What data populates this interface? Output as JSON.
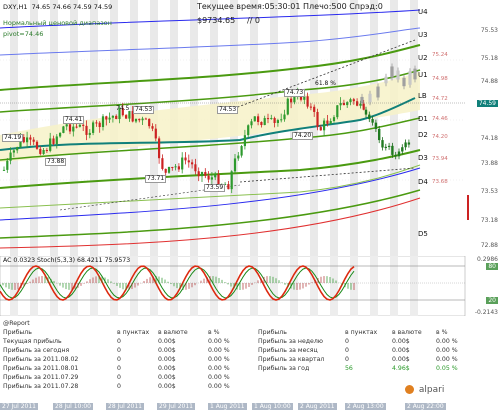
{
  "header": {
    "symbol": "DXY,H1",
    "ohlc": "74.65 74.66 74.59 74.59",
    "server_time": "Текущее время:05:30:01 Плечо:500 Спрэд:0",
    "balance": "$9734.65",
    "separator": "// 0",
    "normal_range": "Нормальный ценовой диапазон",
    "pivot": "pivot=74.46"
  },
  "levels": {
    "right": [
      "U4",
      "U3",
      "U2",
      "U1",
      "LB",
      "D1",
      "D2",
      "D3",
      "D4",
      "D5"
    ],
    "inner_prices": [
      "75.24",
      "74.98",
      "74.72",
      "74.46",
      "74.20",
      "73.94",
      "73.68"
    ],
    "left_labels": [
      "74.19",
      "73.88",
      "74.41",
      "74.5",
      "74.53",
      "73.71",
      "73.59",
      "74.53",
      "74.20",
      "74.73",
      "61.8 %"
    ]
  },
  "price_axis": {
    "ticks": [
      "75.53",
      "75.18",
      "74.88",
      "74.59",
      "74.18",
      "73.88",
      "73.53",
      "73.18",
      "72.88"
    ],
    "current": "74.59"
  },
  "indicator": {
    "label": "AC 0.0323 Stoch(5,3,3) 68.4211 75.9573",
    "ticks": [
      "0.2986",
      "80",
      "20",
      "-0.2143"
    ]
  },
  "report": {
    "title": "@Report",
    "columns": [
      "Прибыль",
      "в пунктах",
      "в валюте",
      "в %"
    ],
    "left_rows": [
      {
        "label": "Текущая прибыль",
        "points": "0",
        "money": "0.00$",
        "pct": "0.00 %"
      },
      {
        "label": "Прибыль за сегодня",
        "points": "0",
        "money": "0.00$",
        "pct": "0.00 %"
      },
      {
        "label": "Прибыль за 2011.08.02",
        "points": "0",
        "money": "0.00$",
        "pct": "0.00 %"
      },
      {
        "label": "Прибыль за 2011.08.01",
        "points": "0",
        "money": "0.00$",
        "pct": "0.00 %"
      },
      {
        "label": "Прибыль за 2011.07.29",
        "points": "0",
        "money": "0.00$",
        "pct": "0.00 %"
      },
      {
        "label": "Прибыль за 2011.07.28",
        "points": "0",
        "money": "0.00$",
        "pct": "0.00 %"
      }
    ],
    "right_rows": [
      {
        "label": "Прибыль за неделю",
        "points": "0",
        "money": "0.00$",
        "pct": "0.00 %"
      },
      {
        "label": "Прибыль за месяц",
        "points": "0",
        "money": "0.00$",
        "pct": "0.00 %"
      },
      {
        "label": "Прибыль за квартал",
        "points": "0",
        "money": "0.00$",
        "pct": "0.00 %"
      },
      {
        "label": "Прибыль за год",
        "points": "56",
        "money": "4.96$",
        "pct": "0.05 %"
      }
    ],
    "logo": "alpari"
  },
  "time_axis": [
    "27 Jul 2011",
    "28 Jul 10:00",
    "28 Jul 2011",
    "29 Jul 2011",
    "1 Aug 2011",
    "1 Aug 10:00",
    "2 Aug 2011",
    "2 Aug 13:00",
    "2 Aug 22:00"
  ],
  "colors": {
    "bull_candle": "#2e9a2e",
    "bear_candle": "#cc2222",
    "band_green": "#4a9a10",
    "band_blue": "#2a2aee",
    "band_red": "#e03030",
    "pivot_teal": "#11807a",
    "forecast_gray": "#9a9a9a",
    "stoch_red": "#dd2a10",
    "stoch_green": "#1a8a1a"
  }
}
